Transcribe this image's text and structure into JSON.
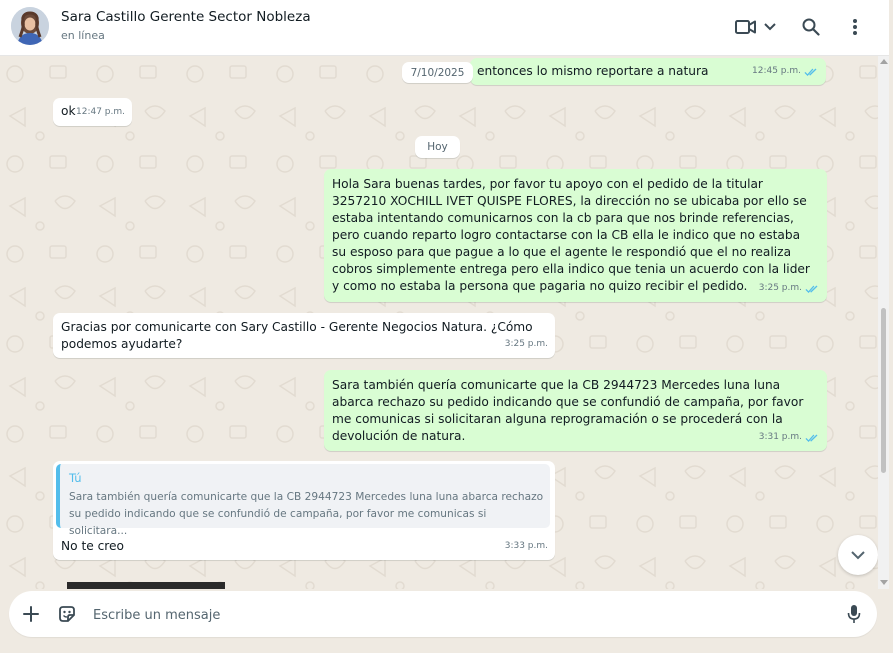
{
  "header": {
    "contact_name": "Sara Castillo Gerente Sector Nobleza",
    "status": "en línea"
  },
  "messages": [
    {
      "dir": "out",
      "text": "entonces lo mismo reportare a natura",
      "time": "12:45 p.m."
    },
    {
      "dir": "in",
      "text": "ok",
      "time": "12:47 p.m."
    },
    {
      "dir": "out",
      "text": "Hola Sara buenas tardes, por favor tu apoyo con el pedido de la titular 3257210 XOCHILL IVET QUISPE FLORES, la dirección no se ubicaba por ello se estaba intentando comunicarnos con la cb para que nos brinde referencias, pero cuando reparto logro contactarse con la CB ella le indico que no estaba su esposo para que pague a lo que el agente le respondió que el no realiza cobros simplemente entrega pero ella indico que tenia un acuerdo con la lider y como no estaba la persona que pagaria no quizo recibir el pedido.",
      "time": "3:25 p.m."
    },
    {
      "dir": "in",
      "text": "Gracias por comunicarte con Sary Castillo - Gerente Negocios Natura. ¿Cómo podemos ayudarte?",
      "time": "3:25 p.m."
    },
    {
      "dir": "out",
      "text": "Sara también quería comunicarte que la CB 2944723 Mercedes luna luna abarca rechazo su pedido indicando que se confundió de campaña, por favor me comunicas si solicitaran alguna reprogramación o se procederá con la devolución de natura.",
      "time": "3:31 p.m."
    },
    {
      "dir": "in",
      "text": "No te creo",
      "time": "3:33 p.m.",
      "quote_author": "Tú",
      "quote_text": "Sara también quería comunicarte que la CB 2944723 Mercedes luna luna abarca   rechazo su pedido indicando que se confundió de campaña, por favor me comunicas si solicitara..."
    }
  ],
  "dates": {
    "floating": "7/10/2025",
    "today": "Hoy"
  },
  "composer": {
    "placeholder": "Escribe un mensaje"
  },
  "icons": {
    "video": "video-camera-icon",
    "search": "search-icon",
    "menu": "more-vertical-icon",
    "add": "plus-icon",
    "sticker": "sticker-icon",
    "mic": "microphone-icon",
    "scroll": "chevron-down-icon"
  },
  "colors": {
    "outgoing_bubble": "#d9fdd3",
    "incoming_bubble": "#ffffff",
    "read_ticks": "#53bdeb",
    "chat_background": "#efeae2"
  }
}
